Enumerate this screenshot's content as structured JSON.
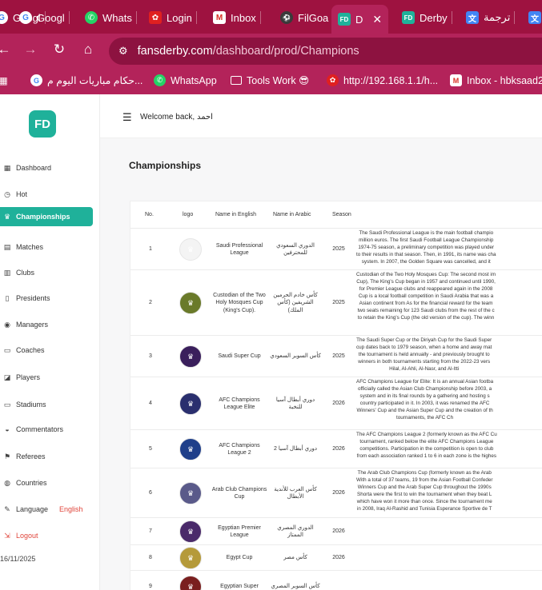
{
  "browser": {
    "tabs": [
      {
        "label": "Googl",
        "icon": "google-icon"
      },
      {
        "label": "Whats",
        "icon": "whatsapp-icon"
      },
      {
        "label": "Login",
        "icon": "huawei-icon"
      },
      {
        "label": "Inbox",
        "icon": "gmail-icon"
      },
      {
        "label": "FilGoa",
        "icon": "filgoal-icon"
      },
      {
        "label": "D",
        "icon": "fd-icon"
      },
      {
        "label": "Derby",
        "icon": "fd-icon"
      },
      {
        "label": "ترجمة",
        "icon": "translate-icon"
      },
      {
        "label": "",
        "icon": "translate-icon"
      }
    ],
    "url_host": "fansderby.com",
    "url_path": "/dashboard/prod/Champions",
    "bookmarks": [
      {
        "label": "حكام مباريات اليوم م...",
        "icon": "google-icon"
      },
      {
        "label": "WhatsApp",
        "icon": "whatsapp-icon"
      },
      {
        "label": "Tools Work 😎",
        "icon": "folder-icon"
      },
      {
        "label": "http://192.168.1.1/h...",
        "icon": "huawei-icon"
      },
      {
        "label": "Inbox - hbksaad20",
        "icon": "gmail-icon"
      }
    ]
  },
  "app": {
    "logo_text": "FD",
    "welcome": "Welcome back, احمد",
    "page_title": "Championships",
    "sidebar": [
      {
        "label": "Dashboard",
        "icon": "grid-icon"
      },
      {
        "label": "Hot",
        "icon": "clock-icon"
      },
      {
        "label": "Championships",
        "icon": "trophy-icon"
      },
      {
        "label": "Matches",
        "icon": "calendar-icon"
      },
      {
        "label": "Clubs",
        "icon": "building-icon"
      },
      {
        "label": "Presidents",
        "icon": "person-icon"
      },
      {
        "label": "Managers",
        "icon": "user-icon"
      },
      {
        "label": "Coaches",
        "icon": "whistle-icon"
      },
      {
        "label": "Players",
        "icon": "shirt-icon"
      },
      {
        "label": "Stadiums",
        "icon": "stadium-icon"
      },
      {
        "label": "Commentators",
        "icon": "mic-icon"
      },
      {
        "label": "Referees",
        "icon": "flag-icon"
      },
      {
        "label": "Countries",
        "icon": "globe-icon"
      },
      {
        "label": "Language",
        "icon": "language-icon",
        "value": "English"
      },
      {
        "label": "Logout",
        "icon": "logout-icon"
      }
    ],
    "footer_date": "16/11/2025",
    "accent": "#1fb19a",
    "table": {
      "headers": [
        "No.",
        "logo",
        "Name in English",
        "Name in Arabic",
        "Season",
        ""
      ],
      "rows": [
        {
          "no": "1",
          "en": "Saudi Professional League",
          "ar": "الدوري السعودي للمحترفين",
          "season": "2025",
          "color": "#f4f4f4",
          "desc": "The Saudi Professional League is the main football champio\nmillion euros. The first Saudi Football League Championship\n1974-75 season, a preliminary competition was played under\nto their results in that season. Then, in 1991, its name was cha\nsystem. In 2007, the Golden Square was cancelled, and it"
        },
        {
          "no": "2",
          "en": "Custodian of the Two Holy Mosques Cup (King's Cup).",
          "ar": "كأس خادم الحرمين الشريفين (كأس الملك)",
          "season": "2025",
          "color": "#6a7a2a",
          "desc": "Custodian of the Two Holy Mosques Cup: The second most im\nCup), The King's Cup began in 1957 and continued until 1990,\nfor Premier League clubs and reappeared again in the 2008\nCup is a local football competition in Saudi Arabia that was a\nAsian continent from As for the financial reward for the team\ntwo seats remaining for 123 Saudi clubs from the rest of the c\nto retain the King's Cup (the old version of the cup). The winn"
        },
        {
          "no": "3",
          "en": "Saudi Super Cup",
          "ar": "كأس السوبر السعودي",
          "season": "2025",
          "color": "#3a1f5c",
          "desc": "The Saudi Super Cup or the Diriyah Cup for the Saudi Super\ncup dates back to 1979 season, when a home and away mat\nthe tournament is held annually - and previously brought to\nwinners in both tournaments starting from the 2022-23 vers\nHilal, Al-Ahli, Al-Nasr, and Al-Itti"
        },
        {
          "no": "4",
          "en": "AFC Champions League Elite",
          "ar": "دوري أبطال آسيا للنخبة",
          "season": "2026",
          "color": "#2a2f6e",
          "desc": "AFC Champions League for Elite: It is an annual Asian footba\nofficially called the Asian Club Championship before 2003, a\nsystem and in its final rounds by a gathering and hosting s\ncountry participated in it. In 2003, it was renamed the AFC\nWinners' Cup and the Asian Super Cup and the creation of th\ntournaments, the AFC Ch"
        },
        {
          "no": "5",
          "en": "AFC Champions League 2",
          "ar": "دوري أبطال آسيا 2",
          "season": "2026",
          "color": "#1f3f8a",
          "desc": "The AFC Champions League 2 (formerly known as the AFC Cu\ntournament, ranked below the elite AFC Champions League\ncompetitions. Participation in the competition is open to club\nfrom each association ranked 1 to 6 in each zone is the highes"
        },
        {
          "no": "6",
          "en": "Arab Club Champions Cup",
          "ar": "كأس العرب للأندية الأبطال",
          "season": "2026",
          "color": "#5a5a8a",
          "desc": "The Arab Club Champions Cup (formerly known as the Arab\nWith a total of 37 teams, 19 from the Asian Football Confeder\nWinners Cup and the Arab Super Cup throughout the 1990s\nShorta were the first to win the tournament when they beat L\nwhich have won it more than once. Since the tournament me\nin 2008, Iraq Al-Rashid and Tunisia Esperance Sportive de T"
        },
        {
          "no": "7",
          "en": "Egyptian Premier League",
          "ar": "الدوري المصري الممتاز",
          "season": "2026",
          "color": "#4a2a6a",
          "desc": ""
        },
        {
          "no": "8",
          "en": "Egypt Cup",
          "ar": "كأس مصر",
          "season": "2026",
          "color": "#b59a3a",
          "desc": ""
        },
        {
          "no": "9",
          "en": "Egyptian Super",
          "ar": "كأس السوبر المصري",
          "season": "",
          "color": "#7a1f1f",
          "desc": ""
        }
      ]
    }
  }
}
